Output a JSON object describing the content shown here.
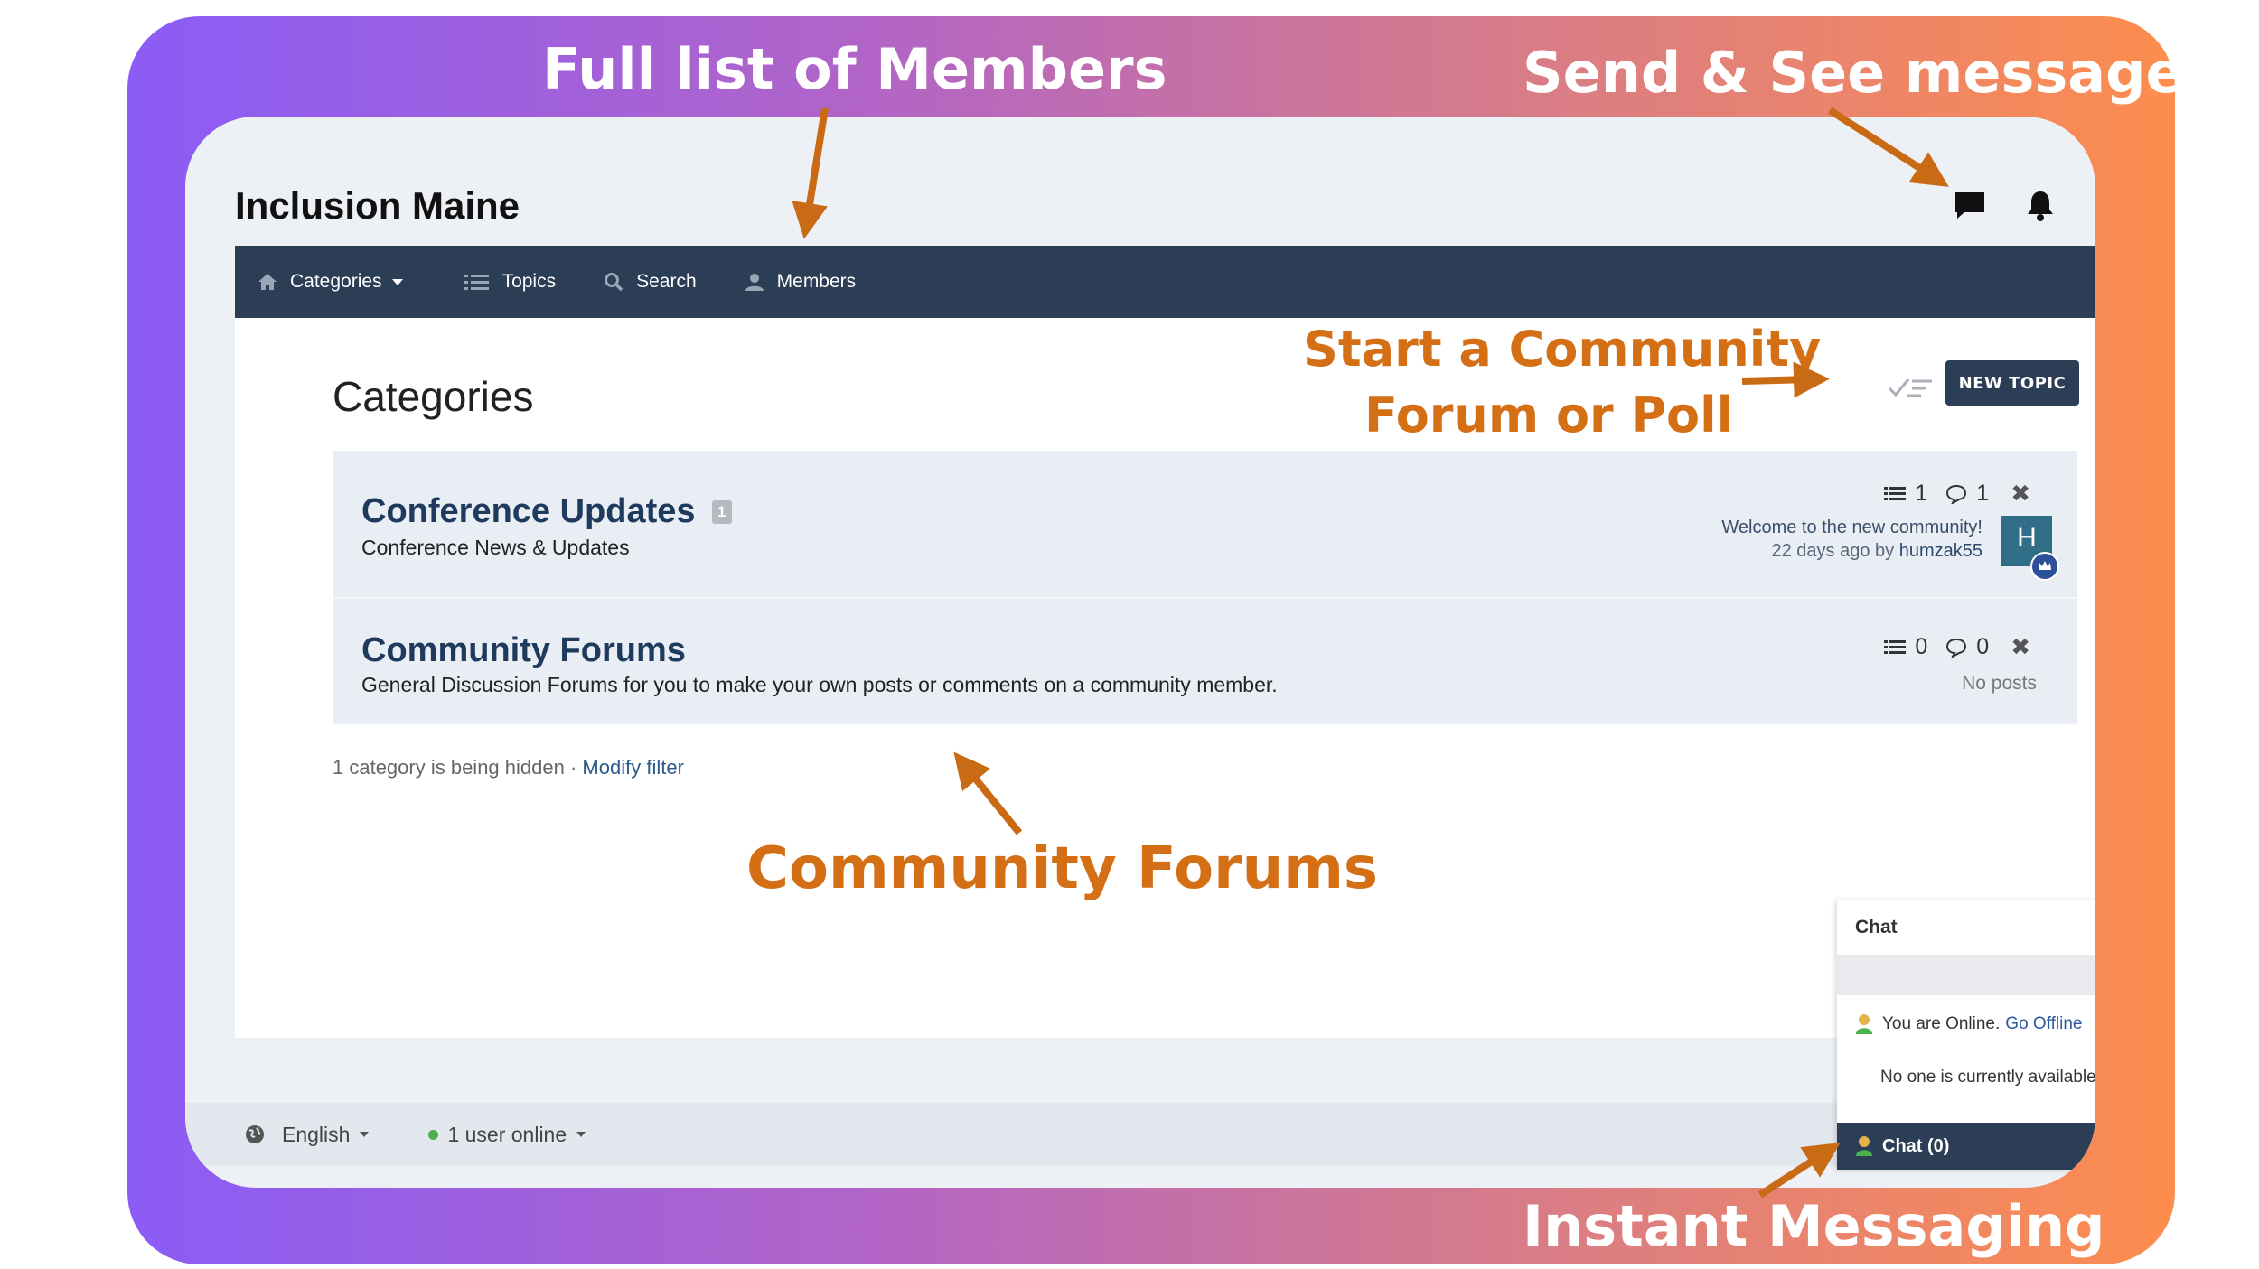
{
  "callouts": {
    "members": "Full list of Members",
    "messages": "Send & See messages",
    "start_forum_line1": "Start a Community",
    "start_forum_line2": "Forum or Poll",
    "community_forums": "Community Forums",
    "instant_messaging": "Instant Messaging"
  },
  "header": {
    "brand": "Inclusion Maine"
  },
  "nav": {
    "categories": "Categories",
    "topics": "Topics",
    "search": "Search",
    "members": "Members"
  },
  "main": {
    "title": "Categories",
    "new_topic_label": "NEW TOPIC",
    "categories": [
      {
        "name": "Conference Updates",
        "badge": "1",
        "description": "Conference News & Updates",
        "topics": "1",
        "posts": "1",
        "latest_title": "Welcome to the new community!",
        "latest_time": "22 days ago by",
        "latest_user": "humzak55",
        "avatar_letter": "H"
      },
      {
        "name": "Community Forums",
        "description": "General Discussion Forums for you to make your own posts or comments on a community member.",
        "topics": "0",
        "posts": "0",
        "latest_none": "No posts"
      }
    ],
    "hidden_note": "1 category is being hidden",
    "hidden_sep": " · ",
    "modify_filter": "Modify filter"
  },
  "footer": {
    "language": "English",
    "users_online": "1 user online"
  },
  "chat": {
    "title": "Chat",
    "online_status": "You are Online.",
    "go_offline": "Go Offline",
    "no_one": "No one is currently available",
    "chat_button": "Chat (0)"
  },
  "colors": {
    "navy": "#2c3e55",
    "callout_orange": "#d46f15",
    "arrow_orange": "#c96a14",
    "gradient_start": "#8b5cf6",
    "gradient_end": "#fd8d4e"
  }
}
